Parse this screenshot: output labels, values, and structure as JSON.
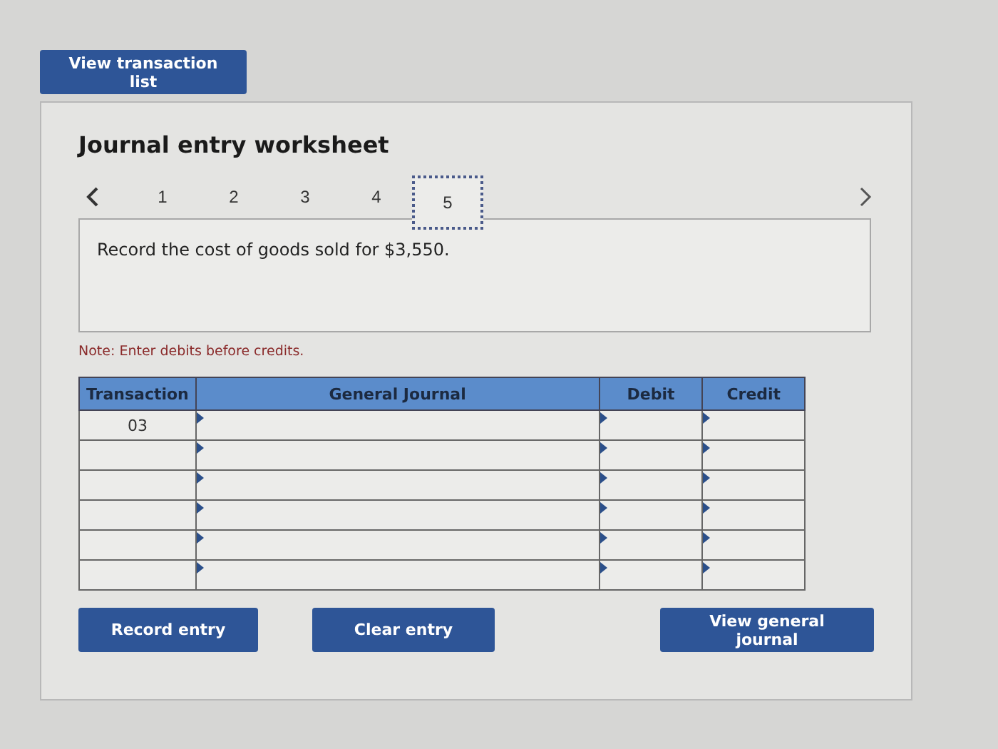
{
  "top_button": "View transaction list",
  "worksheet": {
    "title": "Journal entry worksheet",
    "tabs": [
      {
        "label": "1",
        "selected": false
      },
      {
        "label": "2",
        "selected": false
      },
      {
        "label": "3",
        "selected": false
      },
      {
        "label": "4",
        "selected": false
      },
      {
        "label": "5",
        "selected": true
      }
    ],
    "instruction": "Record the cost of goods sold for $3,550.",
    "note": "Note: Enter debits before credits.",
    "table": {
      "columns": [
        "Transaction",
        "General Journal",
        "Debit",
        "Credit"
      ],
      "rows": [
        {
          "transaction": "03"
        },
        {},
        {},
        {},
        {},
        {}
      ]
    },
    "buttons": [
      "Record entry",
      "Clear entry",
      "View general journal"
    ]
  }
}
